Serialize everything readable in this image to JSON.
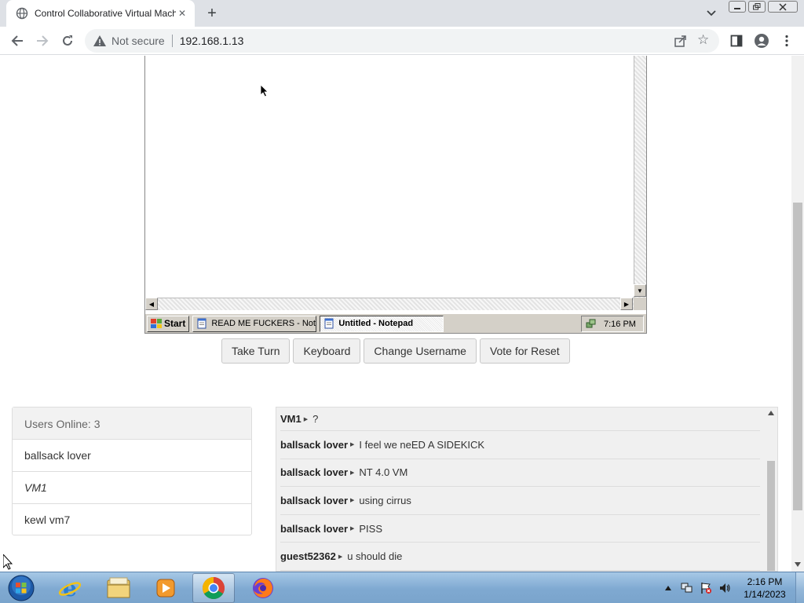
{
  "browser": {
    "tab_title": "Control Collaborative Virtual Machine",
    "security_label": "Not secure",
    "url": "192.168.1.13"
  },
  "vm": {
    "start_label": "Start",
    "tasks": [
      {
        "label": "READ ME FUCKERS - Not..."
      },
      {
        "label": "Untitled - Notepad"
      }
    ],
    "clock": "7:16 PM"
  },
  "controls": {
    "take_turn": "Take Turn",
    "keyboard": "Keyboard",
    "change_username": "Change Username",
    "vote_reset": "Vote for Reset"
  },
  "users": {
    "header": "Users Online: 3",
    "list": [
      "ballsack lover",
      "VM1",
      "kewl vm7"
    ]
  },
  "chat": {
    "messages": [
      {
        "user": "VM1",
        "text": "?"
      },
      {
        "user": "ballsack lover",
        "text": "I feel we neED A SIDEKICK"
      },
      {
        "user": "ballsack lover",
        "text": "NT 4.0 VM"
      },
      {
        "user": "ballsack lover",
        "text": "using cirrus"
      },
      {
        "user": "ballsack lover",
        "text": "PISS"
      },
      {
        "user": "guest52362",
        "text": "u should die"
      }
    ]
  },
  "taskbar": {
    "time": "2:16 PM",
    "date": "1/14/2023",
    "apps": [
      "internet-explorer-icon",
      "file-explorer-icon",
      "media-player-icon",
      "chrome-icon",
      "firefox-icon"
    ],
    "active_app": "chrome-icon"
  },
  "colors": {
    "browser_tabbar": "#dee1e6",
    "win7_taskbar": "#8db4d8",
    "chat_bg": "#f0f0f0",
    "w2k_gray": "#d4d0c8"
  }
}
